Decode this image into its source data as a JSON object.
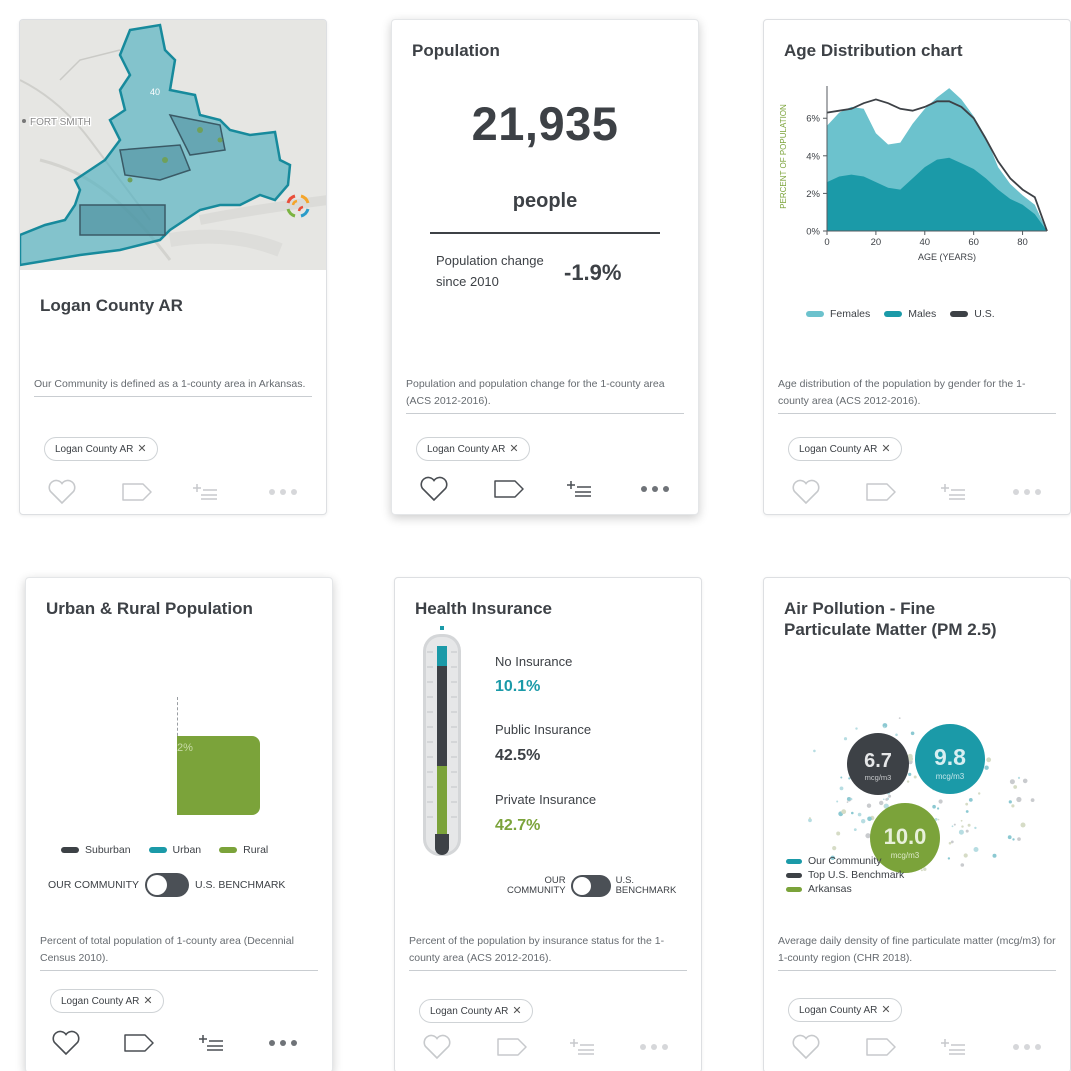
{
  "colors": {
    "teal": "#1b9aa8",
    "light_teal": "#6cc2cd",
    "dark": "#3d4146",
    "green": "#7ba33a"
  },
  "cards": {
    "map_card": {
      "map_label": "FORT SMITH",
      "highway_label": "40",
      "title": "Logan County AR",
      "description": "Our Community is defined as a 1-county area in Arkansas.",
      "chip_label": "Logan County AR",
      "chip_close": "✕"
    },
    "population_card": {
      "title": "Population",
      "value": "21,935",
      "unit": "people",
      "change_label": "Population change since 2010",
      "change_value": "-1.9%",
      "description": "Population and population change for the 1-county area (ACS 2012-2016).",
      "chip_label": "Logan County AR",
      "chip_close": "✕"
    },
    "age_card": {
      "title": "Age Distribution chart",
      "description": "Age distribution of the population by gender for the 1-county area (ACS 2012-2016).",
      "chip_label": "Logan County AR",
      "chip_close": "✕"
    },
    "urban_card": {
      "title": "Urban & Rural Population",
      "bar_label": "2%",
      "legend": [
        "Suburban",
        "Urban",
        "Rural"
      ],
      "toggle_left": "OUR COMMUNITY",
      "toggle_right": "U.S. BENCHMARK",
      "description": "Percent of total population of 1-county area (Decennial Census 2010).",
      "chip_label": "Logan County AR",
      "chip_close": "✕"
    },
    "insurance_card": {
      "title": "Health Insurance",
      "items": [
        {
          "label": "No Insurance",
          "value": "10.1%",
          "color": "#1b9aa8"
        },
        {
          "label": "Public Insurance",
          "value": "42.5%",
          "color": "#3d4146"
        },
        {
          "label": "Private Insurance",
          "value": "42.7%",
          "color": "#7ba33a"
        }
      ],
      "toggle_left_1": "OUR",
      "toggle_left_2": "COMMUNITY",
      "toggle_right_1": "U.S.",
      "toggle_right_2": "BENCHMARK",
      "description": "Percent of the population by insurance status for the 1-county area (ACS 2012-2016).",
      "chip_label": "Logan County AR",
      "chip_close": "✕"
    },
    "air_card": {
      "title_line1": "Air Pollution - Fine",
      "title_line2": "Particulate Matter (PM 2.5)",
      "bubbles": [
        {
          "value": "6.7",
          "unit": "mcg/m3"
        },
        {
          "value": "9.8",
          "unit": "mcg/m3"
        },
        {
          "value": "10.0",
          "unit": "mcg/m3"
        }
      ],
      "legend": [
        "Our Community",
        "Top U.S. Benchmark",
        "Arkansas"
      ],
      "description": "Average daily density of fine particulate matter (mcg/m3) for 1-county region (CHR 2018).",
      "chip_label": "Logan County AR",
      "chip_close": "✕"
    }
  },
  "chart_data": {
    "type": "area",
    "title": "Age Distribution chart",
    "xlabel": "AGE (YEARS)",
    "ylabel": "PERCENT OF POPULATION",
    "x_ticks": [
      "0",
      "20",
      "40",
      "60",
      "80"
    ],
    "y_ticks": [
      "0%",
      "2%",
      "4%",
      "6%"
    ],
    "xlim": [
      0,
      90
    ],
    "ylim": [
      0,
      7.5
    ],
    "x": [
      0,
      5,
      10,
      15,
      20,
      25,
      30,
      35,
      40,
      45,
      50,
      55,
      60,
      65,
      70,
      75,
      80,
      85,
      90
    ],
    "series": [
      {
        "name": "Females",
        "values": [
          5.6,
          6.3,
          6.6,
          6.5,
          5.2,
          4.6,
          4.7,
          5.7,
          6.5,
          7.1,
          7.6,
          7.0,
          6.1,
          5.0,
          3.4,
          2.5,
          1.9,
          1.4,
          0.0
        ]
      },
      {
        "name": "Males",
        "values": [
          2.6,
          2.9,
          3.0,
          2.9,
          2.6,
          2.3,
          2.2,
          2.8,
          3.4,
          3.8,
          3.9,
          3.6,
          3.3,
          2.8,
          2.2,
          1.7,
          1.4,
          0.9,
          0.0
        ]
      },
      {
        "name": "U.S.",
        "values": [
          6.3,
          6.4,
          6.5,
          6.8,
          7.0,
          6.8,
          6.5,
          6.4,
          6.6,
          6.9,
          6.9,
          6.6,
          6.0,
          4.9,
          3.7,
          2.8,
          2.2,
          1.8,
          0.0
        ]
      }
    ],
    "legend_position": "bottom",
    "grid": false
  }
}
